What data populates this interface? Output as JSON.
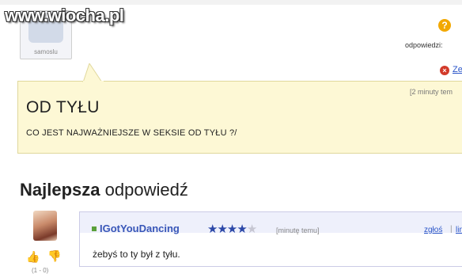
{
  "watermark": "www.wiocha.pl",
  "header": {
    "avatar_caption": "samoslu",
    "answers_label": "odpowiedzi:",
    "close_label": "Ze"
  },
  "question": {
    "time": "[2 minuty tem",
    "title": "OD TYŁU",
    "body": "CO JEST NAJWAŻNIEJSZE W SEKSIE OD TYŁU ?/"
  },
  "best_answer": {
    "heading_bold": "Najlepsza",
    "heading_rest": "odpowiedź",
    "username": "IGotYouDancing",
    "rating": 3.5,
    "rating_max": 5,
    "time": "[minutę temu]",
    "report_label": "zgłoś",
    "separator": "|",
    "more_label": "lin",
    "text": "żebyś to ty był z tyłu.",
    "votes": "(1 - 0)"
  },
  "colors": {
    "question_bg": "#fdf8d5",
    "username": "#3856b8",
    "link": "#2a55c8",
    "star_on": "#2c48a8"
  }
}
